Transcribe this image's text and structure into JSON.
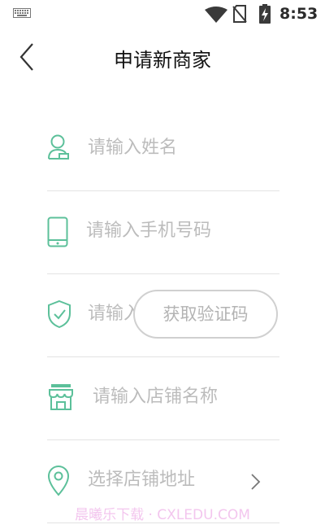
{
  "status_bar": {
    "time": "8:53",
    "icons": [
      "keyboard-icon",
      "wifi-icon",
      "no-sim-icon",
      "battery-charging-icon"
    ]
  },
  "header": {
    "title": "申请新商家",
    "back_icon": "chevron-left-icon"
  },
  "form": {
    "name": {
      "placeholder": "请输入姓名",
      "icon": "user-icon"
    },
    "phone": {
      "placeholder": "请输入手机号码",
      "icon": "phone-icon"
    },
    "code": {
      "placeholder": "请输入验证码",
      "icon": "shield-check-icon",
      "button_label": "获取验证码"
    },
    "store_name": {
      "placeholder": "请输入店铺名称",
      "icon": "store-icon"
    },
    "address": {
      "placeholder": "选择店铺地址",
      "icon": "location-pin-icon",
      "arrow_icon": "chevron-right-icon"
    }
  },
  "watermark": "晨曦乐下载 · CXLEDU.COM",
  "colors": {
    "accent": "#5cc09a",
    "placeholder": "#bcbcbc",
    "divider": "#e3e3e3",
    "title": "#111111"
  }
}
